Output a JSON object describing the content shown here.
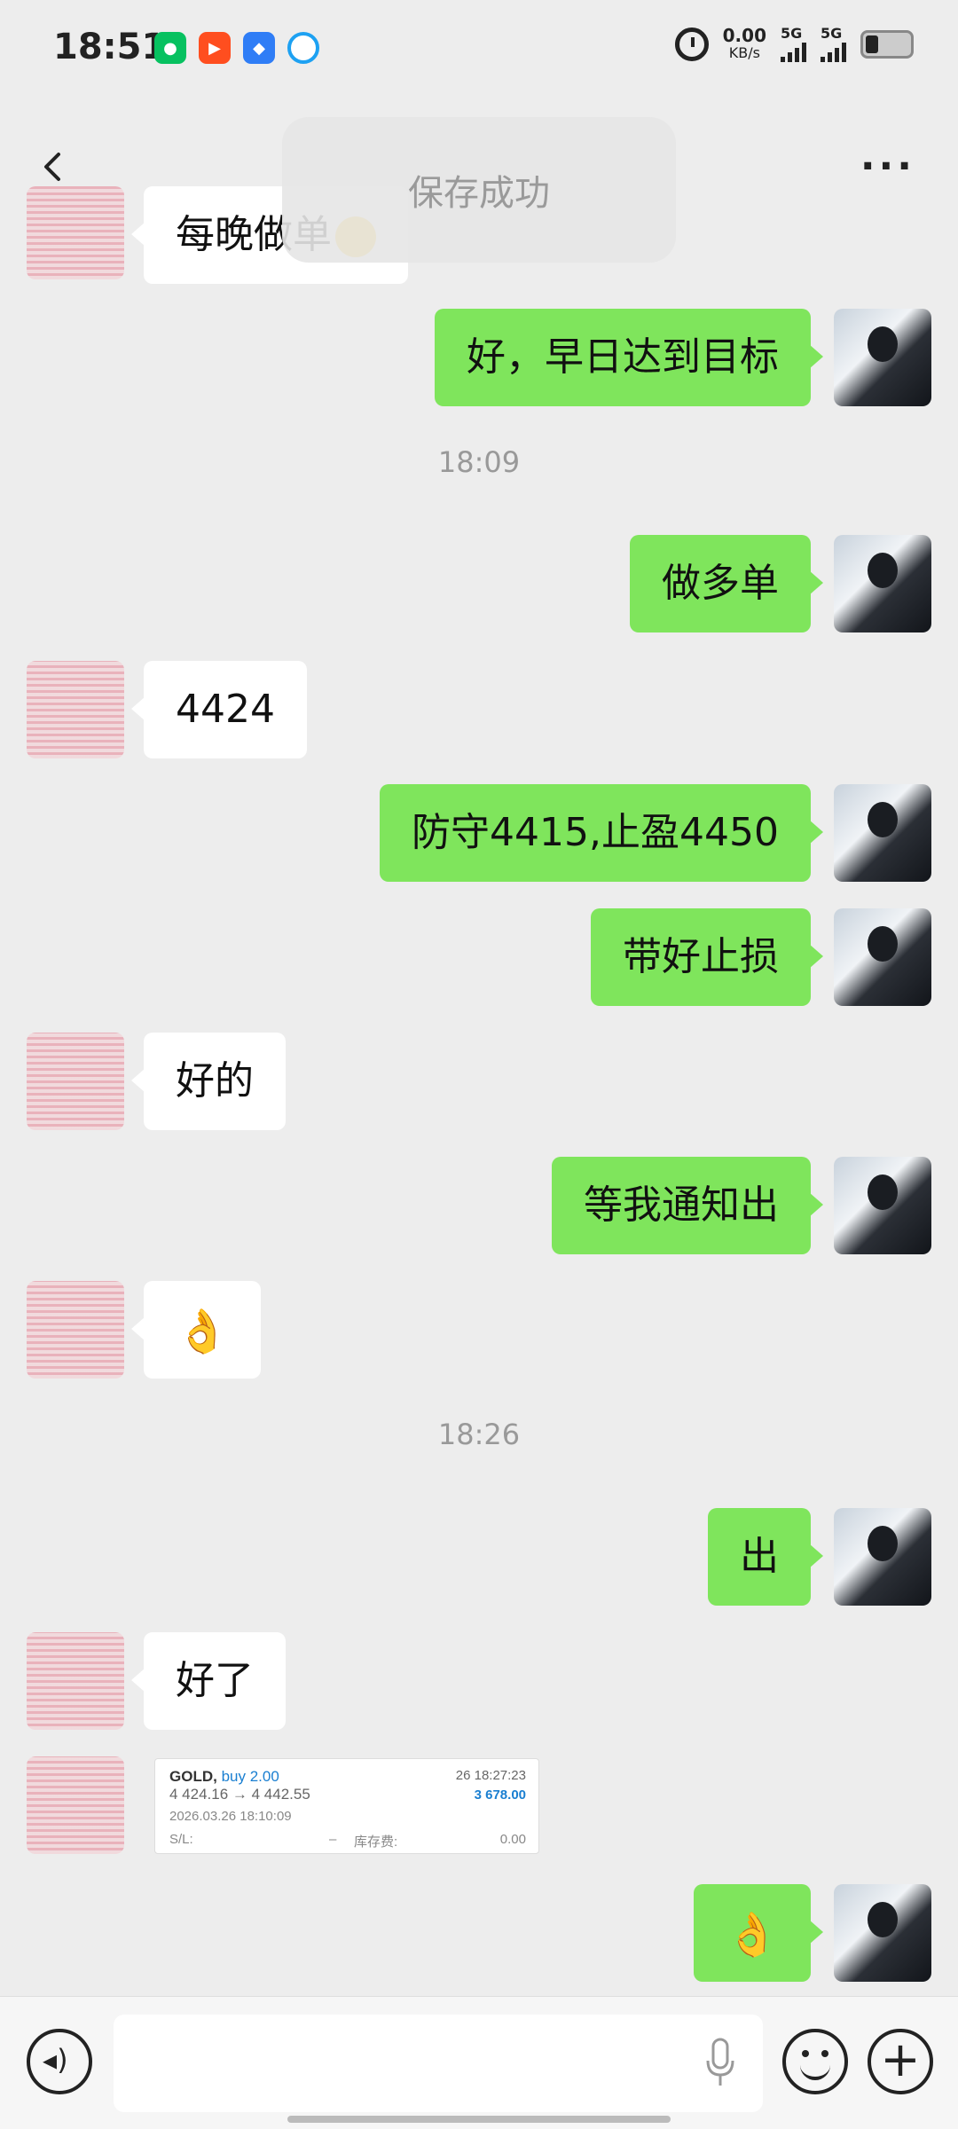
{
  "status_bar": {
    "time": "18:51",
    "net_speed": "0.00",
    "net_unit": "KB/s",
    "sim1": "5G",
    "sim2": "5G"
  },
  "title_bar": {
    "toast": "保存成功"
  },
  "messages": {
    "partial_top": "每晚做单",
    "m1": "好，早日达到目标",
    "time1": "18:09",
    "m2": "做多单",
    "m3": "4424",
    "m4": "防守4415,止盈4450",
    "m5": "带好止损",
    "m6": "好的",
    "m7": "等我通知出",
    "m8_emoji": "👌",
    "time2": "18:26",
    "m9": "出",
    "m10": "好了",
    "m11_emoji": "👌"
  },
  "trade_card": {
    "symbol": "GOLD,",
    "side": "buy 2.00",
    "prices": "4 424.16 → 4 442.55",
    "open_time": "2026.03.26 18:10:09",
    "close_time": "26 18:27:23",
    "profit": "3 678.00",
    "sl_label": "S/L:",
    "sl_value": "–",
    "swap_label": "库存费:",
    "swap_value": "0.00"
  },
  "colors": {
    "self_bubble": "#7fe55c",
    "other_bubble": "#ffffff",
    "background": "#ededed"
  }
}
